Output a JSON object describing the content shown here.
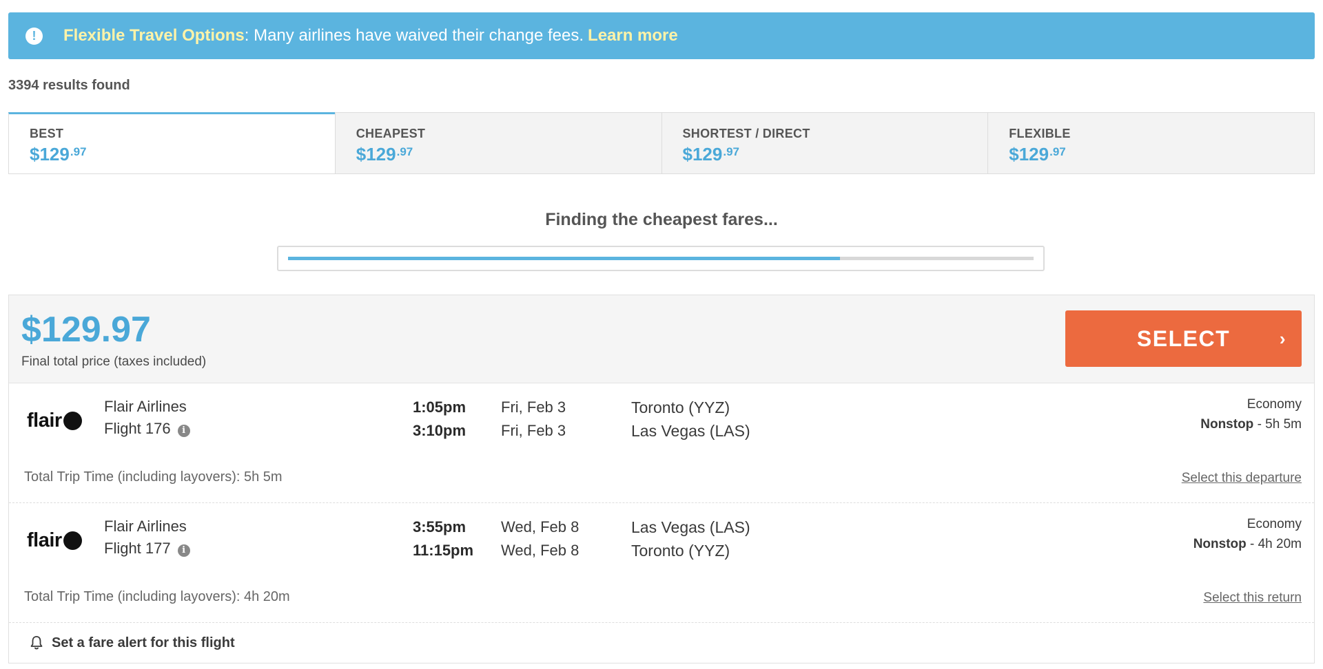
{
  "banner": {
    "title": "Flexible Travel Options",
    "message": ": Many airlines have waived their change fees.",
    "link": "Learn more",
    "icon": "exclamation-icon",
    "color": "#5bb4df"
  },
  "results": {
    "count_text": "3394 results found"
  },
  "tabs": [
    {
      "label": "BEST",
      "price_main": "$129",
      "price_cents": ".97",
      "active": true
    },
    {
      "label": "CHEAPEST",
      "price_main": "$129",
      "price_cents": ".97",
      "active": false
    },
    {
      "label": "SHORTEST / DIRECT",
      "price_main": "$129",
      "price_cents": ".97",
      "active": false
    },
    {
      "label": "FLEXIBLE",
      "price_main": "$129",
      "price_cents": ".97",
      "active": false
    }
  ],
  "search": {
    "status": "Finding the cheapest fares...",
    "progress": 0.74
  },
  "offer": {
    "price": "$129.97",
    "price_note": "Final total price (taxes included)",
    "select_label": "SELECT",
    "select_color": "#ec6a3f",
    "outbound": {
      "logo_text": "flair",
      "airline": "Flair Airlines",
      "flight": "Flight 176",
      "depart_time": "1:05pm",
      "arrive_time": "3:10pm",
      "depart_date": "Fri, Feb 3",
      "arrive_date": "Fri, Feb 3",
      "origin": "Toronto (YYZ)",
      "destination": "Las Vegas (LAS)",
      "cabin": "Economy",
      "stops": "Nonstop",
      "duration": " - 5h 5m",
      "trip_time": "Total Trip Time (including layovers): 5h 5m",
      "select_link": "Select this departure"
    },
    "return": {
      "logo_text": "flair",
      "airline": "Flair Airlines",
      "flight": "Flight 177",
      "depart_time": "3:55pm",
      "arrive_time": "11:15pm",
      "depart_date": "Wed, Feb 8",
      "arrive_date": "Wed, Feb 8",
      "origin": "Las Vegas (LAS)",
      "destination": "Toronto (YYZ)",
      "cabin": "Economy",
      "stops": "Nonstop",
      "duration": " - 4h 20m",
      "trip_time": "Total Trip Time (including layovers): 4h 20m",
      "select_link": "Select this return"
    },
    "fare_alert": "Set a fare alert for this flight"
  },
  "icons": {
    "info": "info-icon",
    "bell": "bell-icon",
    "chevron": "chevron-right-icon"
  }
}
